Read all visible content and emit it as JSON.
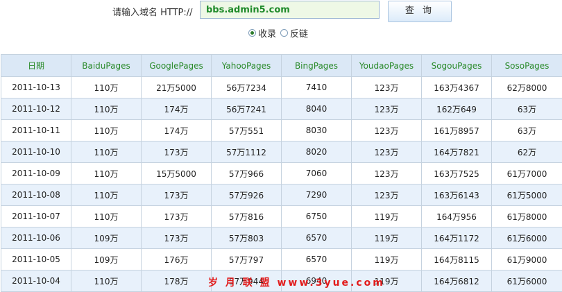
{
  "form": {
    "label": "请输入域名 HTTP://",
    "domain_value": "bbs.admin5.com",
    "query_button": "查 询",
    "radio_options": [
      {
        "label": "收录",
        "selected": true
      },
      {
        "label": "反链",
        "selected": false
      }
    ]
  },
  "table": {
    "headers": [
      "日期",
      "BaiduPages",
      "GooglePages",
      "YahooPages",
      "BingPages",
      "YoudaoPages",
      "SogouPages",
      "SosoPages"
    ],
    "rows": [
      [
        "2011-10-13",
        "110万",
        "21万5000",
        "56万7234",
        "7410",
        "123万",
        "163万4367",
        "62万8000"
      ],
      [
        "2011-10-12",
        "110万",
        "174万",
        "56万7241",
        "8040",
        "123万",
        "162万649",
        "63万"
      ],
      [
        "2011-10-11",
        "110万",
        "174万",
        "57万551",
        "8030",
        "123万",
        "161万8957",
        "63万"
      ],
      [
        "2011-10-10",
        "110万",
        "173万",
        "57万1112",
        "8020",
        "123万",
        "164万7821",
        "62万"
      ],
      [
        "2011-10-09",
        "110万",
        "15万5000",
        "57万966",
        "7060",
        "123万",
        "163万7525",
        "61万7000"
      ],
      [
        "2011-10-08",
        "110万",
        "173万",
        "57万926",
        "7290",
        "123万",
        "163万6143",
        "61万5000"
      ],
      [
        "2011-10-07",
        "110万",
        "173万",
        "57万816",
        "6750",
        "119万",
        "164万956",
        "61万8000"
      ],
      [
        "2011-10-06",
        "109万",
        "173万",
        "57万803",
        "6570",
        "119万",
        "164万1172",
        "61万6000"
      ],
      [
        "2011-10-05",
        "109万",
        "176万",
        "57万797",
        "6570",
        "119万",
        "164万8115",
        "61万9000"
      ],
      [
        "2011-10-04",
        "110万",
        "178万",
        "57万944",
        "6940",
        "119万",
        "164万6812",
        "61万6000"
      ]
    ]
  },
  "watermark": "岁 月 联 盟  www.3yue.com",
  "colors": {
    "header_bg": "#dbe8f6",
    "header_text": "#2a8a2a",
    "alt_row_bg": "#e8f1fb",
    "input_bg": "#eef8e6",
    "input_text": "#1f8a2a",
    "watermark": "#e21b1b"
  }
}
